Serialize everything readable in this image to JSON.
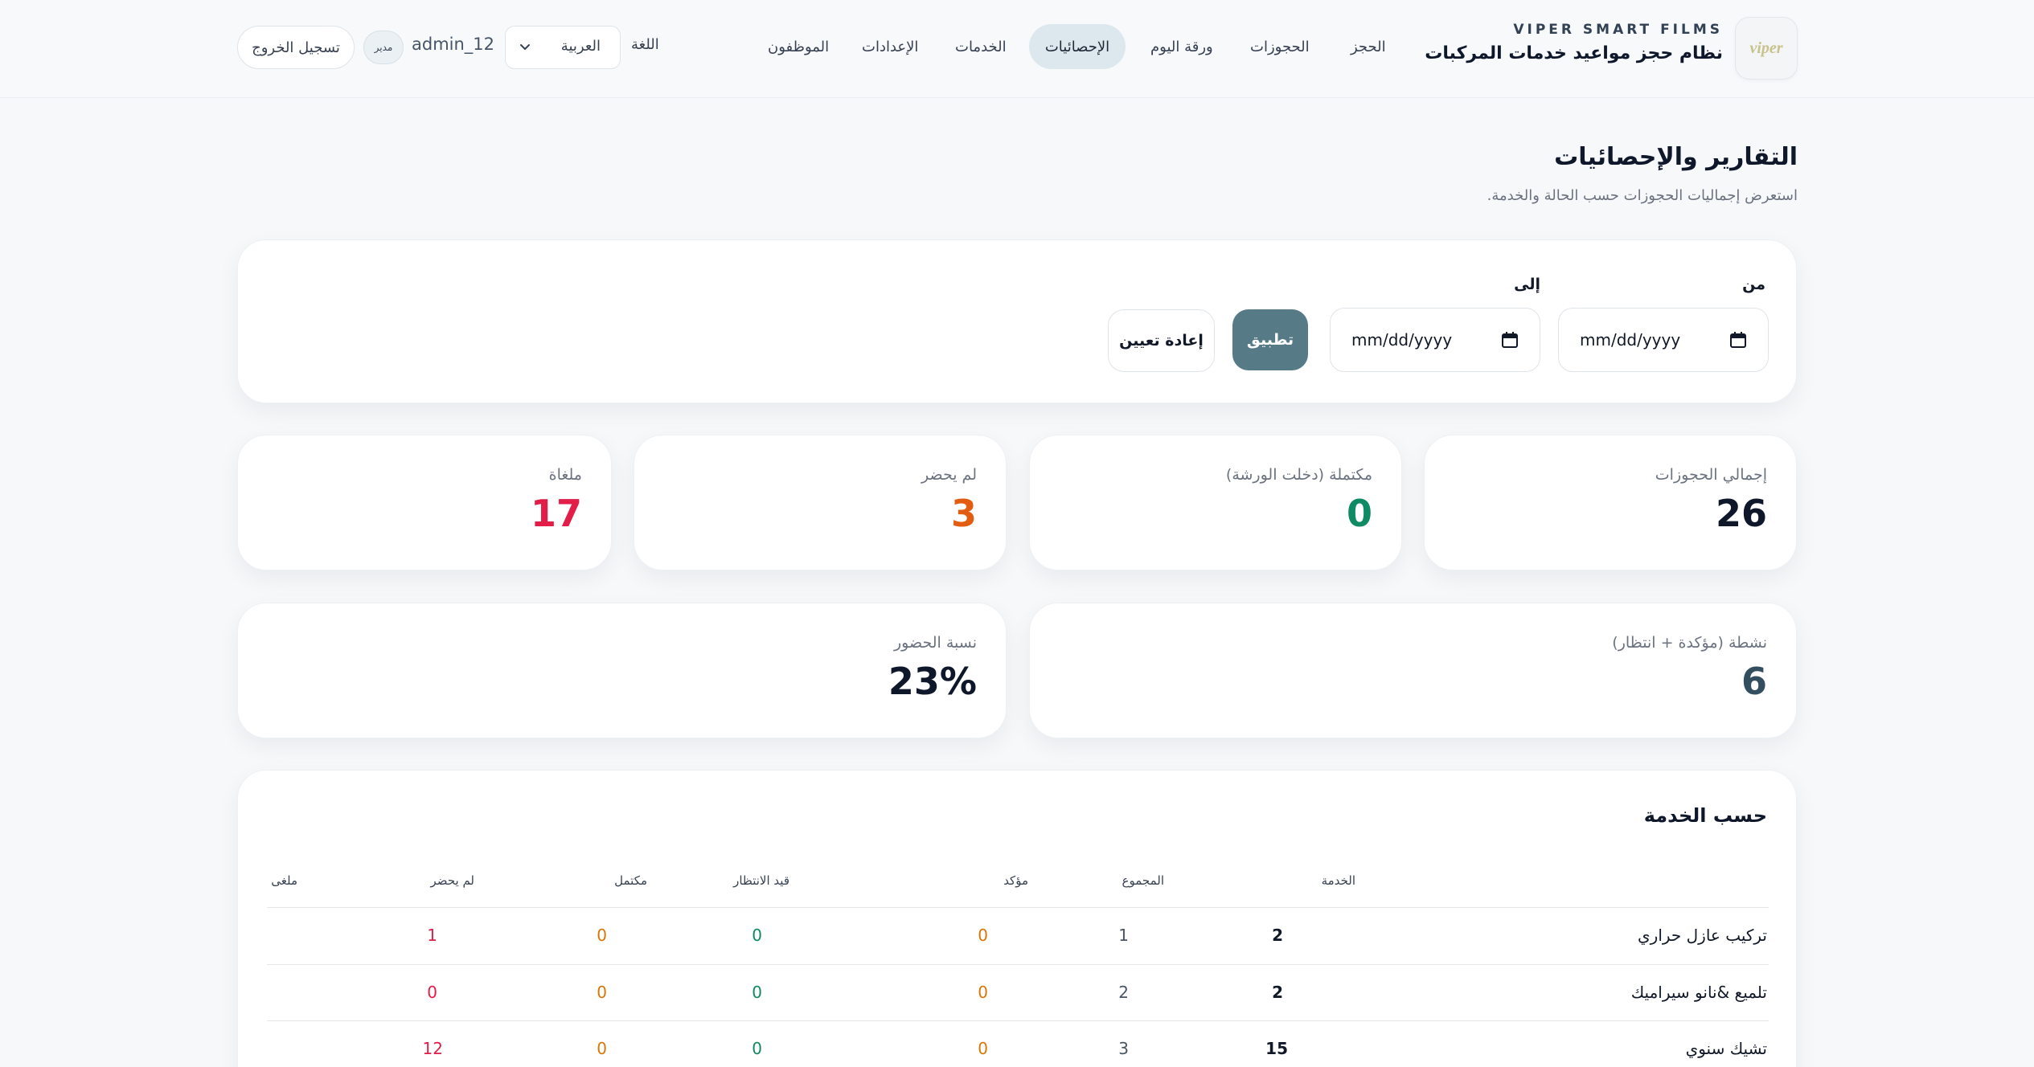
{
  "brand": {
    "logo_text": "viper",
    "name": "VIPER SMART FILMS",
    "title": "نظام حجز مواعيد خدمات المركبات"
  },
  "nav": {
    "items": [
      {
        "label": "الحجز",
        "active": false
      },
      {
        "label": "الحجوزات",
        "active": false
      },
      {
        "label": "ورقة اليوم",
        "active": false
      },
      {
        "label": "الإحصائيات",
        "active": true
      },
      {
        "label": "الخدمات",
        "active": false
      },
      {
        "label": "الإعدادات",
        "active": false
      },
      {
        "label": "الموظفون",
        "active": false
      }
    ]
  },
  "user_bar": {
    "language_label": "اللغة",
    "language_value": "العربية",
    "username": "admin_12",
    "role": "مدير",
    "logout_label": "تسجيل الخروج"
  },
  "page": {
    "title": "التقارير والإحصائيات",
    "subtitle": "استعرض إجماليات الحجوزات حسب الحالة والخدمة."
  },
  "filters": {
    "from_label": "من",
    "to_label": "إلى",
    "from_placeholder": "mm/dd/yyyy",
    "to_placeholder": "mm/dd/yyyy",
    "apply_label": "تطبيق",
    "reset_label": "إعادة تعيين"
  },
  "stats": {
    "total": {
      "label": "إجمالي الحجوزات",
      "value": "26",
      "color": "#0f172a"
    },
    "completed": {
      "label": "مكتملة (دخلت الورشة)",
      "value": "0",
      "color": "#0f8a62"
    },
    "no_show": {
      "label": "لم يحضر",
      "value": "3",
      "color": "#e35d10"
    },
    "cancelled": {
      "label": "ملغاة",
      "value": "17",
      "color": "#e11d48"
    },
    "active": {
      "label": "نشطة (مؤكدة + انتظار)",
      "value": "6",
      "color": "#334e5e"
    },
    "attendance": {
      "label": "نسبة الحضور",
      "value": "23%",
      "color": "#0f172a"
    }
  },
  "by_service": {
    "title": "حسب الخدمة",
    "headers": {
      "service": "الخدمة",
      "total": "المجموع",
      "confirmed": "مؤكد",
      "pending": "قيد الانتظار",
      "completed": "مكتمل",
      "no_show": "لم يحضر",
      "cancelled": "ملغى"
    },
    "rows": [
      {
        "service": "تركيب عازل حراري",
        "total": "2",
        "confirmed": "1",
        "pending": "0",
        "completed": "0",
        "no_show": "0",
        "cancelled": "1"
      },
      {
        "service": "تلميع &نانو سيراميك",
        "total": "2",
        "confirmed": "2",
        "pending": "0",
        "completed": "0",
        "no_show": "0",
        "cancelled": "0"
      },
      {
        "service": "تشيك سنوي",
        "total": "15",
        "confirmed": "3",
        "pending": "0",
        "completed": "0",
        "no_show": "0",
        "cancelled": "12"
      }
    ],
    "colors": {
      "confirmed": "#4b5563",
      "pending": "#d97706",
      "completed": "#0f8a62",
      "no_show": "#d97706",
      "cancelled": "#e11d48"
    }
  }
}
